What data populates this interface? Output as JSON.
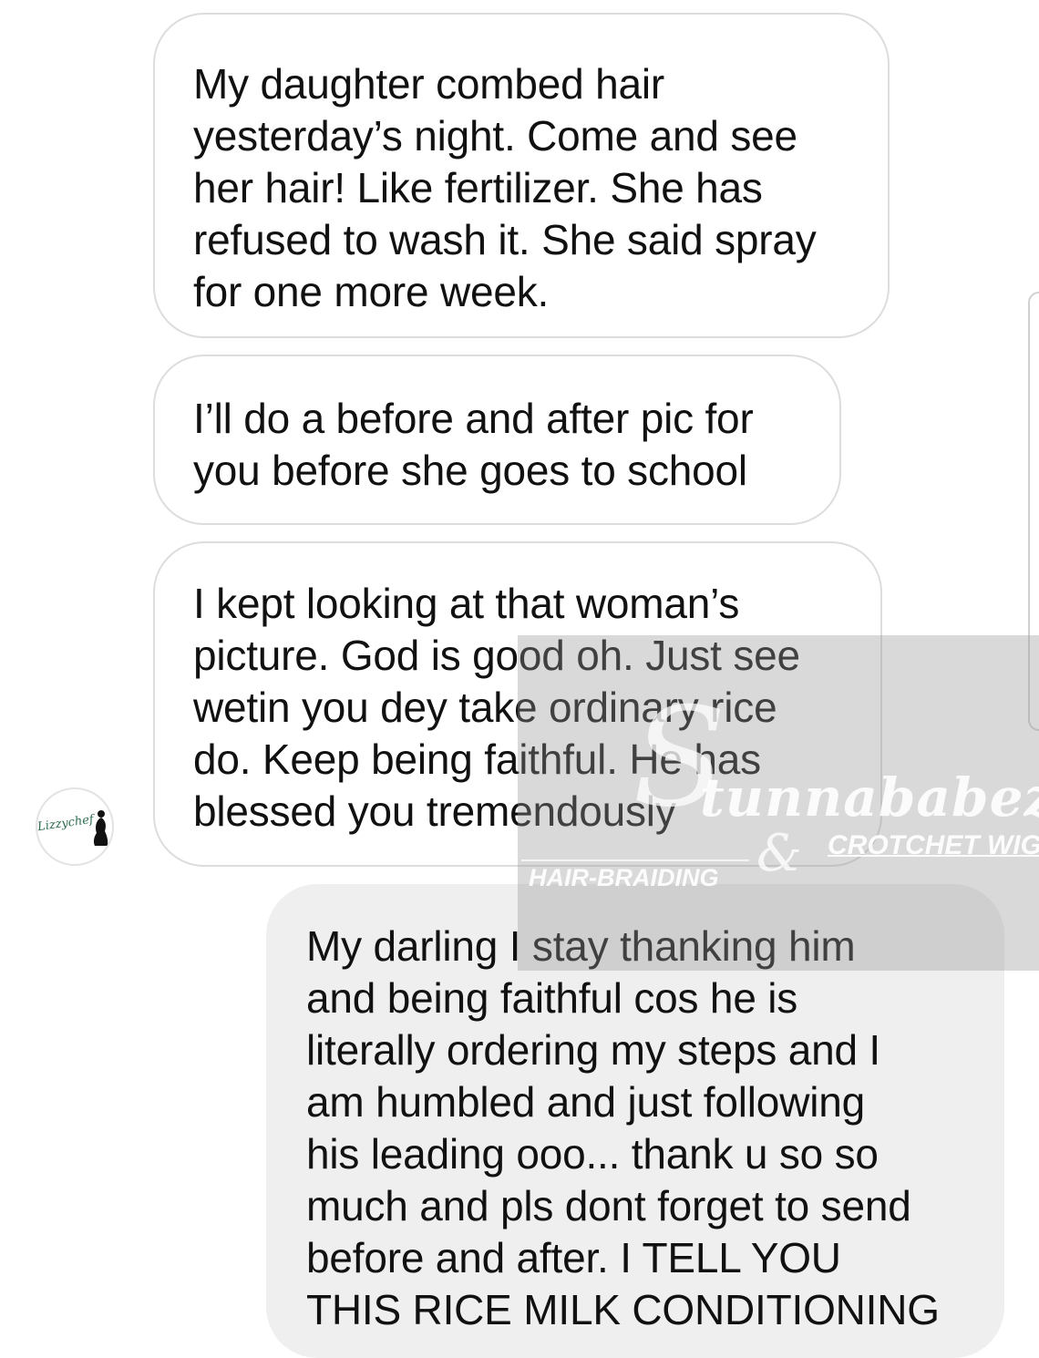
{
  "messages": [
    {
      "direction": "incoming",
      "lines": [
        "My daughter combed hair",
        "yesterday’s night. Come and see",
        "her hair! Like fertilizer. She has",
        "refused to wash it. She said spray",
        "for one more week."
      ]
    },
    {
      "direction": "incoming",
      "lines": [
        "I’ll do a before and after pic for",
        "you before she goes to school"
      ]
    },
    {
      "direction": "incoming",
      "lines": [
        "I kept looking at that woman’s",
        "picture. God is good oh. Just see",
        "wetin you dey take ordinary rice",
        "do. Keep being faithful. He has",
        "blessed you tremendously"
      ]
    },
    {
      "direction": "outgoing",
      "lines": [
        "My darling I stay thanking him",
        "and being faithful cos he is",
        "literally ordering my steps and I",
        "am humbled and just following",
        "his leading ooo... thank u so so",
        "much and pls dont forget to send",
        "before and after. I TELL YOU",
        "THIS RICE MILK CONDITIONING"
      ]
    }
  ],
  "avatar": {
    "logo_text": "Lizzychef",
    "icon": "woman-silhouette-icon"
  },
  "watermark": {
    "initial": "S",
    "brand": "tunnababez",
    "ampersand": "&",
    "crotchet": "CROTCHET WIG",
    "hair": "HAIR-BRAIDING"
  },
  "colors": {
    "incoming_bubble": "#ffffff",
    "incoming_border": "#dddddd",
    "outgoing_bubble": "#efefef",
    "text": "#111111",
    "avatar_script": "#2e6e4f"
  }
}
